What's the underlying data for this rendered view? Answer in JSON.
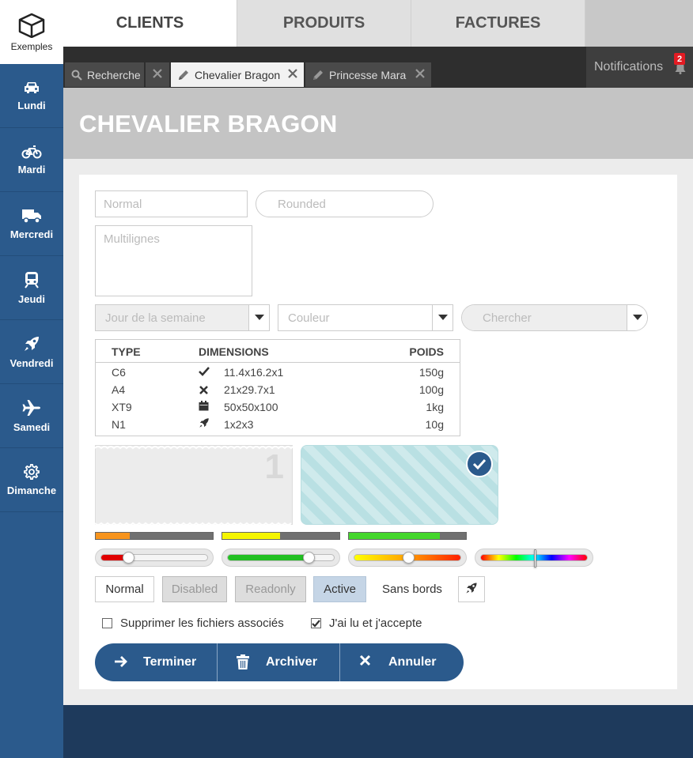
{
  "sidebar": {
    "brand_label": "Exemples",
    "items": [
      {
        "label": "Lundi",
        "icon": "car-icon"
      },
      {
        "label": "Mardi",
        "icon": "bicycle-icon"
      },
      {
        "label": "Mercredi",
        "icon": "truck-icon"
      },
      {
        "label": "Jeudi",
        "icon": "train-icon"
      },
      {
        "label": "Vendredi",
        "icon": "rocket-icon"
      },
      {
        "label": "Samedi",
        "icon": "plane-icon"
      },
      {
        "label": "Dimanche",
        "icon": "gear-icon"
      }
    ]
  },
  "top_tabs": [
    "CLIENTS",
    "PRODUITS",
    "FACTURES"
  ],
  "doc_tabs": [
    {
      "label": "Recherche",
      "icon": "search-icon"
    },
    {
      "label": "Chevalier Bragon",
      "icon": "pencil-icon"
    },
    {
      "label": "Princesse Mara",
      "icon": "pencil-icon"
    }
  ],
  "notifications": {
    "label": "Notifications",
    "count": "2"
  },
  "page_title": "CHEVALIER BRAGON",
  "form": {
    "normal_placeholder": "Normal",
    "rounded_placeholder": "Rounded",
    "multiline_placeholder": "Multilignes",
    "select_day": "Jour de la semaine",
    "select_color": "Couleur",
    "select_search": "Chercher"
  },
  "table": {
    "headers": [
      "TYPE",
      "DIMENSIONS",
      "POIDS"
    ],
    "rows": [
      {
        "type": "C6",
        "icon": "check-icon",
        "dims": "11.4x16.2x1",
        "weight": "150g"
      },
      {
        "type": "A4",
        "icon": "x-icon",
        "dims": "21x29.7x1",
        "weight": "100g"
      },
      {
        "type": "XT9",
        "icon": "calendar-icon",
        "dims": "50x50x100",
        "weight": "1kg"
      },
      {
        "type": "N1",
        "icon": "rocket-icon",
        "dims": "1x2x3",
        "weight": "10g"
      }
    ]
  },
  "ticket_number": "1",
  "progress": [
    {
      "value": 0.29,
      "color": "#f7941d"
    },
    {
      "value": 0.49,
      "color": "#f5f500"
    },
    {
      "value": 0.78,
      "color": "#44d62c"
    }
  ],
  "sliders": [
    {
      "value": 0.25,
      "color": "#e00000"
    },
    {
      "value": 0.75,
      "color": "#22c022"
    },
    {
      "value": 0.5,
      "gradient": "heat"
    },
    {
      "value": 0.5,
      "gradient": "rainbow"
    }
  ],
  "buttons": {
    "normal": "Normal",
    "disabled": "Disabled",
    "readonly": "Readonly",
    "active": "Active",
    "borderless": "Sans bords"
  },
  "checkboxes": {
    "delete_files": {
      "label": "Supprimer les fichiers associés",
      "checked": false
    },
    "accept": {
      "label": "J'ai lu et j'accepte",
      "checked": true
    }
  },
  "actions": {
    "finish": "Terminer",
    "archive": "Archiver",
    "cancel": "Annuler"
  }
}
